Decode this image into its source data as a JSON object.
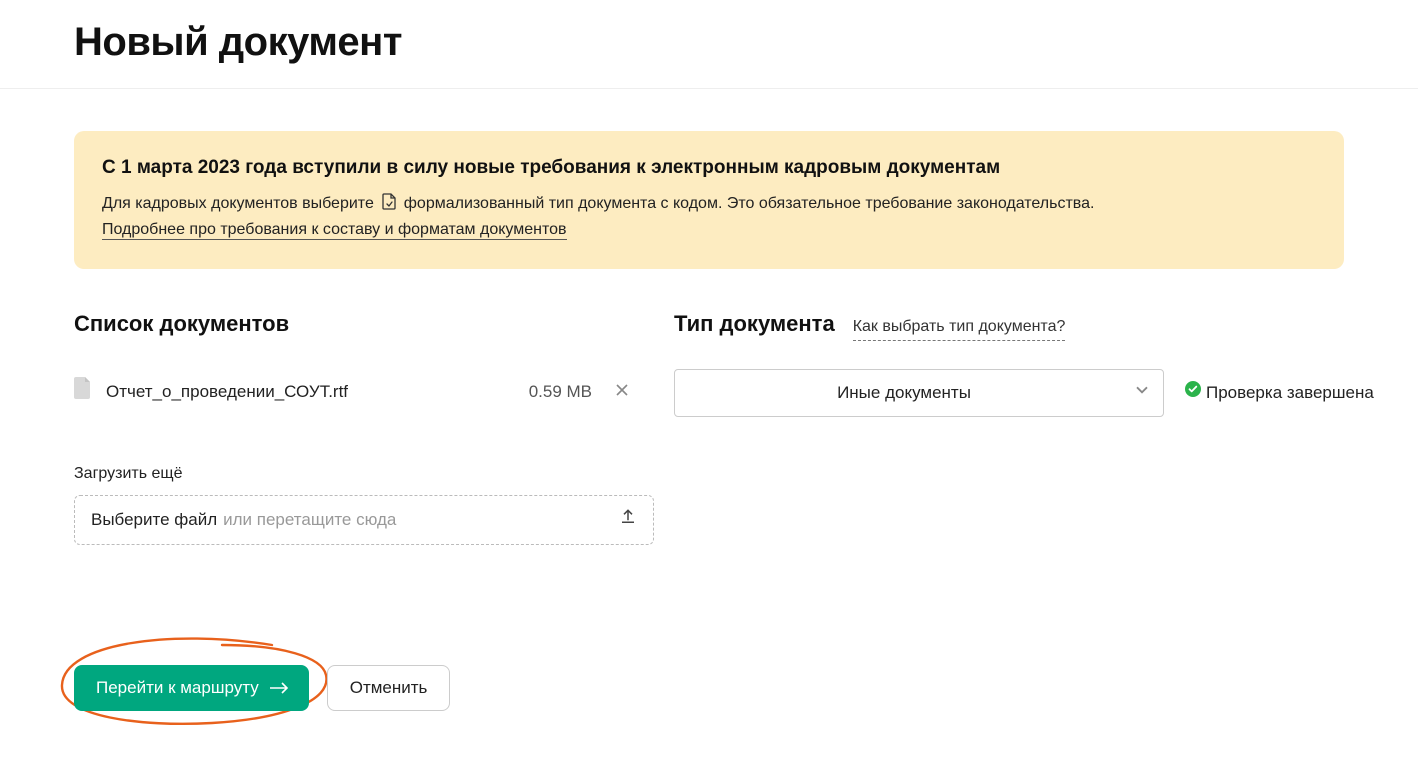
{
  "header": {
    "title": "Новый документ"
  },
  "banner": {
    "title": "С 1 марта 2023 года вступили в силу новые требования к электронным кадровым документам",
    "body_prefix": "Для кадровых документов выберите",
    "body_suffix": "формализованный тип документа с кодом. Это обязательное требование законодательства.",
    "link": "Подробнее про требования к составу и форматам документов"
  },
  "docs": {
    "section_title": "Список документов",
    "file": {
      "name": "Отчет_о_проведении_СОУТ.rtf",
      "size": "0.59 MB"
    }
  },
  "type": {
    "section_title": "Тип документа",
    "help_link": "Как выбрать тип документа?",
    "selected": "Иные документы",
    "status": "Проверка завершена"
  },
  "upload": {
    "label": "Загрузить ещё",
    "action": "Выберите файл",
    "hint": "или перетащите сюда"
  },
  "actions": {
    "primary": "Перейти к маршруту",
    "cancel": "Отменить"
  },
  "colors": {
    "accent": "#00a77f",
    "banner_bg": "#fdecc1",
    "success": "#2bb34b",
    "highlight_stroke": "#e8611c"
  }
}
